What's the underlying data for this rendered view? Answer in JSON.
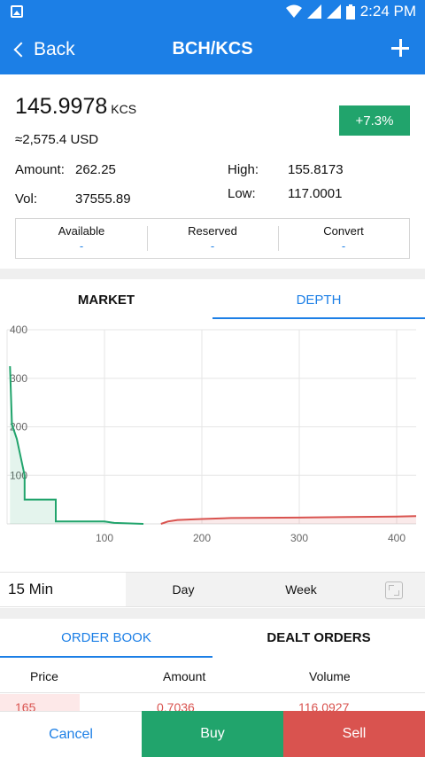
{
  "status_bar": {
    "time": "2:24 PM",
    "icons": [
      "gallery-icon",
      "wifi-icon",
      "signal-icon",
      "battery-icon"
    ]
  },
  "app_bar": {
    "back_label": "Back",
    "title": "BCH/KCS",
    "add_icon": "plus-icon"
  },
  "ticker": {
    "price": "145.9978",
    "unit": "KCS",
    "usd": "≈2,575.4 USD",
    "change": "+7.3%",
    "amount_label": "Amount:",
    "amount_value": "262.25",
    "vol_label": "Vol:",
    "vol_value": "37555.89",
    "high_label": "High:",
    "high_value": "155.8173",
    "low_label": "Low:",
    "low_value": "117.0001"
  },
  "balance": [
    {
      "label": "Available",
      "value": "-"
    },
    {
      "label": "Reserved",
      "value": "-"
    },
    {
      "label": "Convert",
      "value": "-"
    }
  ],
  "chart_tabs": {
    "market": "MARKET",
    "depth": "DEPTH",
    "active": "DEPTH"
  },
  "chart_data": {
    "type": "area",
    "x_ticks": [
      "100",
      "200",
      "300",
      "400"
    ],
    "y_ticks": [
      "100",
      "200",
      "300",
      "400"
    ],
    "xlim": [
      0,
      420
    ],
    "ylim": [
      0,
      400
    ],
    "grid": true,
    "series": [
      {
        "color": "#21a46c",
        "x": [
          3,
          5,
          10,
          18,
          18,
          50,
          50,
          100,
          110,
          140
        ],
        "y": [
          325,
          205,
          175,
          100,
          50,
          50,
          5,
          5,
          2,
          0
        ]
      },
      {
        "color": "#d9534f",
        "x": [
          158,
          165,
          175,
          200,
          230,
          300,
          350,
          400,
          420
        ],
        "y": [
          0,
          5,
          8,
          10,
          12,
          13,
          14,
          15,
          16
        ]
      }
    ]
  },
  "intervals": [
    "15 Min",
    "Day",
    "Week"
  ],
  "book_tabs": {
    "order_book": "ORDER BOOK",
    "dealt_orders": "DEALT ORDERS"
  },
  "order_book": {
    "headers": [
      "Price",
      "Amount",
      "Volume"
    ],
    "rows": [
      {
        "price": "165",
        "amount": "0.7036",
        "volume": "116.0927"
      }
    ]
  },
  "actions": {
    "cancel": "Cancel",
    "buy": "Buy",
    "sell": "Sell"
  },
  "colors": {
    "accent": "#1c7fe6",
    "buy": "#21a46c",
    "sell": "#d9534f"
  }
}
